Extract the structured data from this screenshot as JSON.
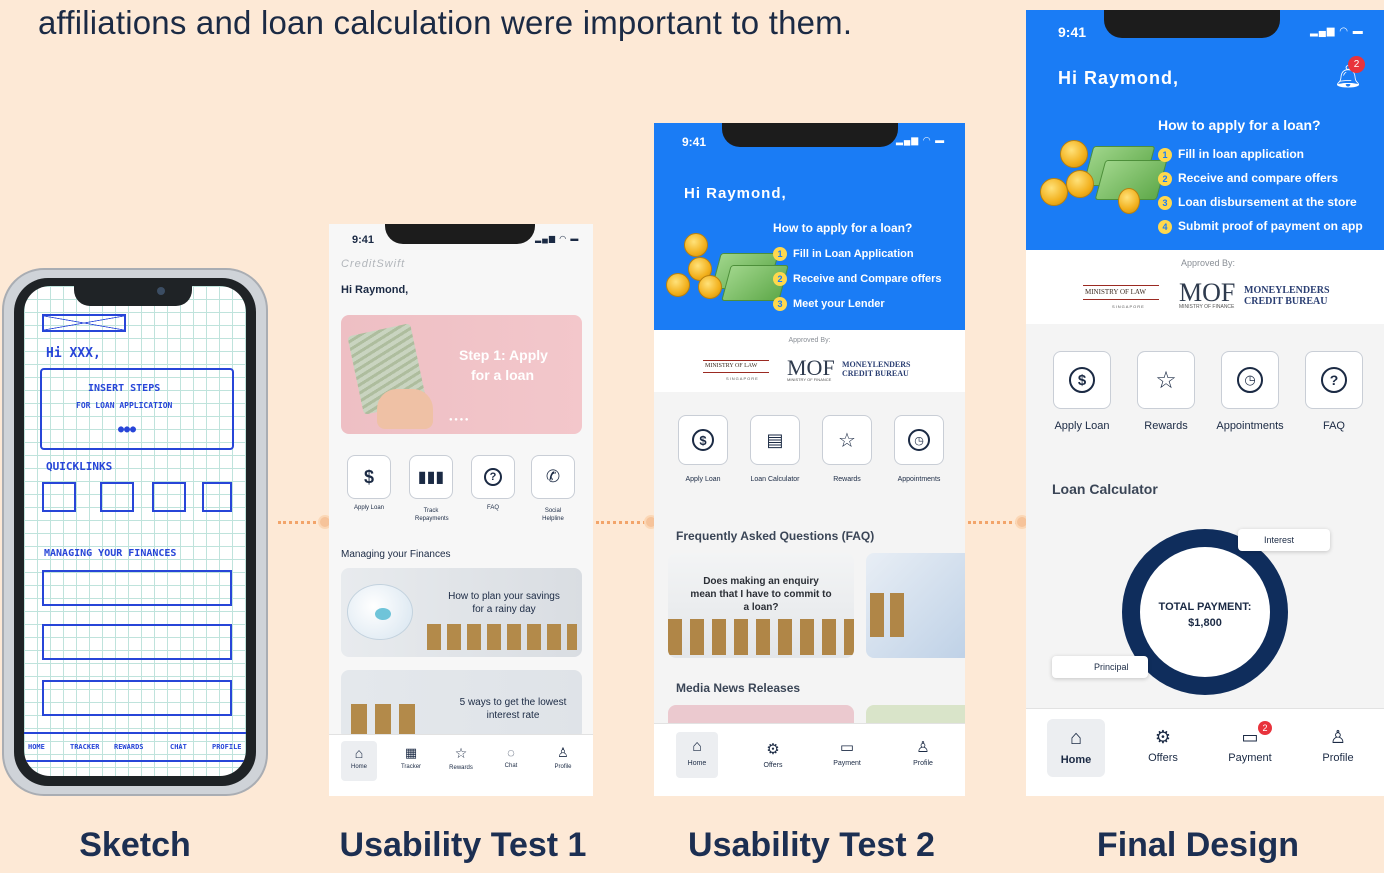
{
  "headline": "affiliations and loan calculation were important to them.",
  "captions": {
    "sketch": "Sketch",
    "ut1": "Usability Test 1",
    "ut2": "Usability Test 2",
    "final": "Final Design"
  },
  "sketch": {
    "greeting": "Hi XXX,",
    "box_line1": "INSERT STEPS",
    "box_line2": "FOR LOAN APPLICATION",
    "quicklinks": "QUICKLINKS",
    "managing": "MANAGING YOUR FINANCES",
    "nav": [
      "HOME",
      "TRACKER",
      "REWARDS",
      "CHAT",
      "PROFILE"
    ]
  },
  "ut1": {
    "time": "9:41",
    "brand": "CreditSwift",
    "greeting": "Hi Raymond,",
    "banner_line1": "Step 1: Apply",
    "banner_line2": "for a loan",
    "quicklinks": [
      {
        "icon": "$",
        "label": "Apply Loan"
      },
      {
        "icon": "bar-chart",
        "label": "Track Repayments"
      },
      {
        "icon": "?",
        "label": "FAQ"
      },
      {
        "icon": "phone",
        "label": "Social Helpline"
      }
    ],
    "section_title": "Managing your Finances",
    "card1": "How to plan your savings for a rainy day",
    "card2": "5 ways to get the lowest interest rate",
    "nav": [
      "Home",
      "Tracker",
      "Rewards",
      "Chat",
      "Profile"
    ]
  },
  "ut2": {
    "time": "9:41",
    "greeting": "Hi Raymond,",
    "how_title": "How to apply for a loan?",
    "steps": [
      "Fill in Loan Application",
      "Receive and Compare offers",
      "Meet your Lender"
    ],
    "approved_by": "Approved By:",
    "logos": {
      "law": "MINISTRY OF LAW",
      "law_sub": "SINGAPORE",
      "mof": "MOF",
      "mof_sub": "MINISTRY OF FINANCE",
      "mlcb": "MONEYLENDERS CREDIT BUREAU"
    },
    "quicklinks": [
      "Apply Loan",
      "Loan Calculator",
      "Rewards",
      "Appointments"
    ],
    "faq_title": "Frequently Asked Questions (FAQ)",
    "faq_card": "Does making an enquiry mean that I have to commit to a loan?",
    "media_title": "Media News Releases",
    "nav": [
      "Home",
      "Offers",
      "Payment",
      "Profile"
    ]
  },
  "final": {
    "time": "9:41",
    "greeting": "Hi Raymond,",
    "notif_count": "2",
    "how_title": "How to apply for a loan?",
    "steps": [
      "Fill in loan application",
      "Receive and compare offers",
      "Loan disbursement at the store",
      "Submit proof of payment on app"
    ],
    "approved_by": "Approved By:",
    "logos": {
      "law": "MINISTRY OF LAW",
      "law_sub": "SINGAPORE",
      "mof": "MOF",
      "mof_sub": "MINISTRY OF FINANCE",
      "mlcb": "MONEYLENDERS CREDIT BUREAU"
    },
    "quicklinks": [
      "Apply Loan",
      "Rewards",
      "Appointments",
      "FAQ"
    ],
    "calc_title": "Loan Calculator",
    "total_label": "TOTAL PAYMENT:",
    "total_value": "$1,800",
    "interest_label": "Interest",
    "principal_label": "Principal",
    "payment_badge": "2",
    "nav": [
      "Home",
      "Offers",
      "Payment",
      "Profile"
    ]
  }
}
